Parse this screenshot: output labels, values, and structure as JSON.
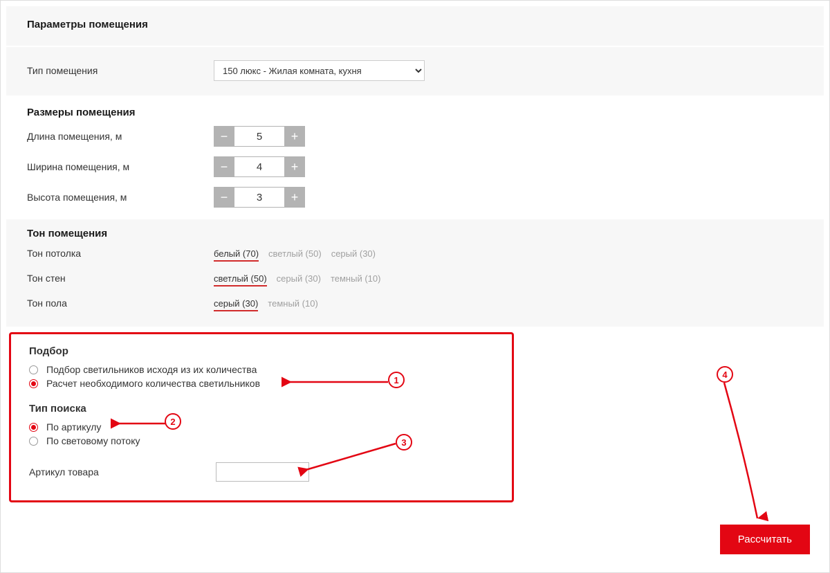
{
  "section_params": "Параметры помещения",
  "room_type_label": "Тип помещения",
  "room_type_selected": "150 люкс - Жилая комната, кухня",
  "section_dims": "Размеры помещения",
  "dims": {
    "length_label": "Длина помещения, м",
    "length_value": "5",
    "width_label": "Ширина помещения, м",
    "width_value": "4",
    "height_label": "Высота помещения, м",
    "height_value": "3"
  },
  "section_tone": "Тон помещения",
  "tones": {
    "ceiling_label": "Тон потолка",
    "ceiling_opts": [
      "белый (70)",
      "светлый (50)",
      "серый (30)"
    ],
    "ceiling_sel": 0,
    "walls_label": "Тон стен",
    "walls_opts": [
      "светлый (50)",
      "серый (30)",
      "темный (10)"
    ],
    "walls_sel": 0,
    "floor_label": "Тон пола",
    "floor_opts": [
      "серый (30)",
      "темный (10)"
    ],
    "floor_sel": 0
  },
  "selection": {
    "title": "Подбор",
    "opt1": "Подбор светильников исходя из их количества",
    "opt2": "Расчет необходимого количества светильников"
  },
  "search": {
    "title": "Тип поиска",
    "opt1": "По артикулу",
    "opt2": "По световому потоку",
    "sku_label": "Артикул товара"
  },
  "calculate": "Рассчитать",
  "callouts": {
    "c1": "1",
    "c2": "2",
    "c3": "3",
    "c4": "4"
  },
  "glyph_minus": "−",
  "glyph_plus": "+"
}
